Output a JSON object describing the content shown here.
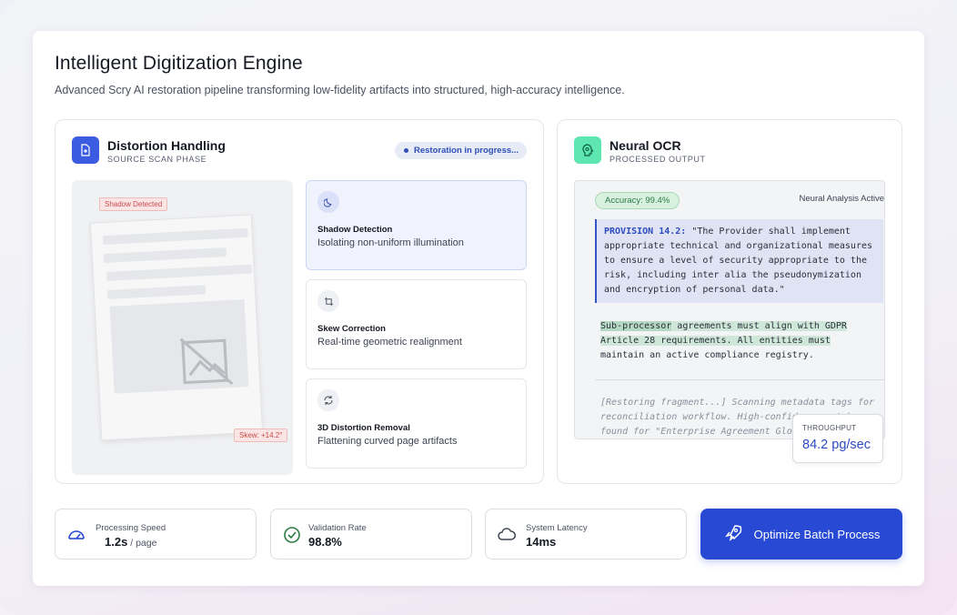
{
  "header": {
    "title": "Intelligent Digitization Engine",
    "subtitle": "Advanced Scry AI restoration pipeline transforming low-fidelity artifacts into structured, high-accuracy intelligence."
  },
  "distortion_panel": {
    "title": "Distortion Handling",
    "subtitle": "SOURCE SCAN PHASE",
    "status": "Restoration in progress...",
    "shadow_tag": "Shadow Detected",
    "skew_tag": "Skew: +14.2°",
    "steps": [
      {
        "title": "Shadow Detection",
        "desc": "Isolating non-uniform illumination",
        "icon": "moon-icon",
        "active": true
      },
      {
        "title": "Skew Correction",
        "desc": "Real-time geometric realignment",
        "icon": "crop-icon",
        "active": false
      },
      {
        "title": "3D Distortion Removal",
        "desc": "Flattening curved page artifacts",
        "icon": "refresh-icon",
        "active": false
      }
    ]
  },
  "ocr_panel": {
    "title": "Neural OCR",
    "subtitle": "PROCESSED OUTPUT",
    "accuracy": "Accuracy: 99.4%",
    "analysis_status": "Neural Analysis Active",
    "provision_label": "PROVISION 14.2:",
    "provision_text_1": " \"The Provider shall implement",
    "provision_text_2": "appropriate technical and organizational measures",
    "provision_text_3": "to ensure a level of security appropriate to the",
    "provision_text_4": "risk, including inter alia the pseudonymization",
    "provision_text_5": "and encryption of personal data.\"",
    "sub_highlight": "Sub-processor",
    "sub_text_1": " agreements must align with GDPR",
    "sub_text_2": "Article 28 requirements. All entities must",
    "sub_text_3": "maintain an active compliance registry.",
    "restoring_1": "[Restoring fragment...] Scanning metadata tags for",
    "restoring_2": "reconciliation workflow. High-confidence match",
    "restoring_3": "found for \"Enterprise Agreement Global\"",
    "throughput_label": "THROUGHPUT",
    "throughput_value": "84.2 pg/sec"
  },
  "metrics": [
    {
      "label": "Processing Speed",
      "value": "1.2s",
      "unit": " / page",
      "icon": "speedometer-icon"
    },
    {
      "label": "Validation Rate",
      "value": "98.8%",
      "unit": "",
      "icon": "check-circle-icon"
    },
    {
      "label": "System Latency",
      "value": "14ms",
      "unit": "",
      "icon": "cloud-icon"
    }
  ],
  "cta": {
    "label": "Optimize Batch Process",
    "icon": "rocket-icon"
  },
  "colors": {
    "accent": "#2749d4",
    "success": "#2b7a43",
    "ocr_icon_bg": "#5ee6b0",
    "distortion_icon_bg": "#3b5be0"
  }
}
